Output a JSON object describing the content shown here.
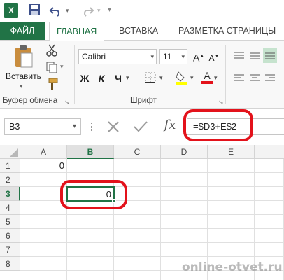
{
  "app": {
    "logo": "X",
    "brand_color": "#217346",
    "icons": [
      "excel-logo",
      "save-icon",
      "undo-icon",
      "redo-icon"
    ]
  },
  "ribbon_tabs": {
    "file": "ФАЙЛ",
    "home": "ГЛАВНАЯ",
    "insert": "ВСТАВКА",
    "layout": "РАЗМЕТКА СТРАНИЦЫ"
  },
  "clipboard": {
    "paste_label": "Вставить",
    "group_label": "Буфер обмена"
  },
  "font": {
    "family": "Calibri",
    "size": "11",
    "group_label": "Шрифт",
    "bold": "Ж",
    "italic": "К",
    "underline": "Ч",
    "grow": "A",
    "shrink": "A",
    "font_color": "A"
  },
  "formula_bar": {
    "name_box": "B3",
    "fx": "fx",
    "formula": "=$D3+E$2"
  },
  "sheet": {
    "columns": [
      "A",
      "B",
      "C",
      "D",
      "E"
    ],
    "rows": [
      "1",
      "2",
      "3",
      "4",
      "5",
      "6",
      "7",
      "8"
    ],
    "selected_column": "B",
    "selected_row": "3",
    "cells": {
      "A1": "0",
      "B3": "0"
    }
  },
  "annotation_color": "#e3121b",
  "watermark": "online-otvet.ru"
}
